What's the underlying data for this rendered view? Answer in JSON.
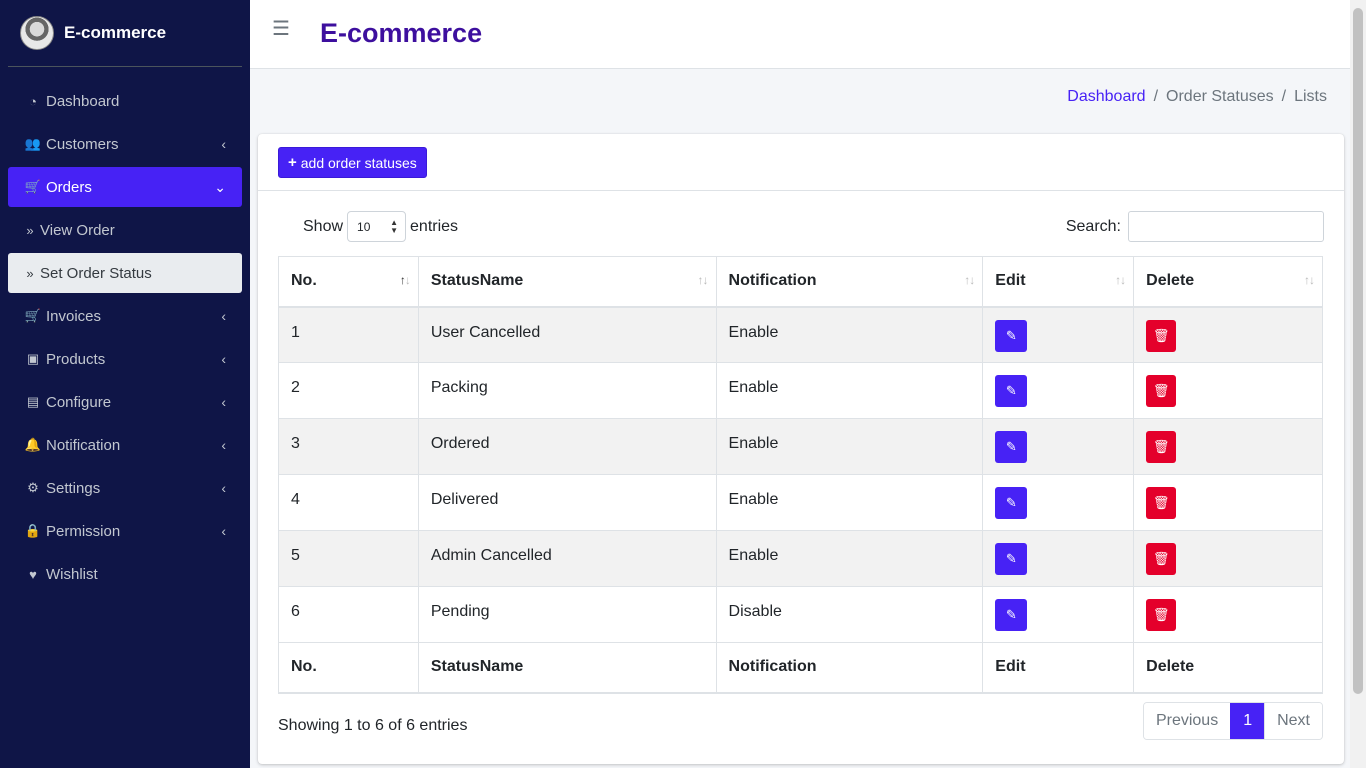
{
  "brand": {
    "name": "E-commerce"
  },
  "header": {
    "title": "E-commerce",
    "menu_icon": "hamburger-icon"
  },
  "sidebar": {
    "items": [
      {
        "label": "Dashboard",
        "icon": "gauge-icon"
      },
      {
        "label": "Customers",
        "icon": "users-icon"
      },
      {
        "label": "Orders",
        "icon": "cart-icon"
      },
      {
        "label": "View Order",
        "icon": "double-chevron-right-icon"
      },
      {
        "label": "Set Order Status",
        "icon": "double-chevron-right-icon"
      },
      {
        "label": "Invoices",
        "icon": "cart-icon"
      },
      {
        "label": "Products",
        "icon": "image-icon"
      },
      {
        "label": "Configure",
        "icon": "book-icon"
      },
      {
        "label": "Notification",
        "icon": "bell-icon"
      },
      {
        "label": "Settings",
        "icon": "gear-icon"
      },
      {
        "label": "Permission",
        "icon": "lock-icon"
      },
      {
        "label": "Wishlist",
        "icon": "heart-icon"
      }
    ]
  },
  "breadcrumb": {
    "items": [
      "Dashboard",
      "Order Statuses",
      "Lists"
    ],
    "separator": "/"
  },
  "toolbar": {
    "add_label": "add order statuses"
  },
  "datatable": {
    "show_label": "Show",
    "length_value": "10",
    "entries_label": "entries",
    "search_label": "Search:",
    "search_value": "",
    "columns": [
      "No.",
      "StatusName",
      "Notification",
      "Edit",
      "Delete"
    ],
    "rows": [
      {
        "no": "1",
        "status": "User Cancelled",
        "notification": "Enable"
      },
      {
        "no": "2",
        "status": "Packing",
        "notification": "Enable"
      },
      {
        "no": "3",
        "status": "Ordered",
        "notification": "Enable"
      },
      {
        "no": "4",
        "status": "Delivered",
        "notification": "Enable"
      },
      {
        "no": "5",
        "status": "Admin Cancelled",
        "notification": "Enable"
      },
      {
        "no": "6",
        "status": "Pending",
        "notification": "Disable"
      }
    ],
    "info": "Showing 1 to 6 of 6 entries",
    "pagination": {
      "previous": "Previous",
      "current": "1",
      "next": "Next"
    }
  },
  "colors": {
    "sidebar_bg": "#0f1547",
    "accent": "#4722f5",
    "danger": "#e4002b",
    "title": "#3d0f9e"
  }
}
